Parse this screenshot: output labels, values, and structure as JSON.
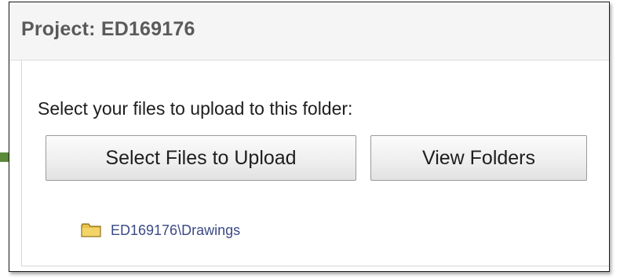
{
  "header": {
    "title": "Project: ED169176"
  },
  "upload": {
    "prompt": "Select your files to upload to this folder:",
    "select_button_label": "Select Files to Upload",
    "view_folders_button_label": "View Folders"
  },
  "folder": {
    "icon": "folder-icon",
    "path": "ED169176\\Drawings"
  },
  "annotation": {
    "arrow_icon": "arrow-right-icon",
    "arrow_color": "#5a8a3a"
  },
  "colors": {
    "header_bg": "#f5f5f5",
    "title_text": "#5a5a5a",
    "link_text": "#3b4a86",
    "folder_yellow": "#e8c34a"
  }
}
